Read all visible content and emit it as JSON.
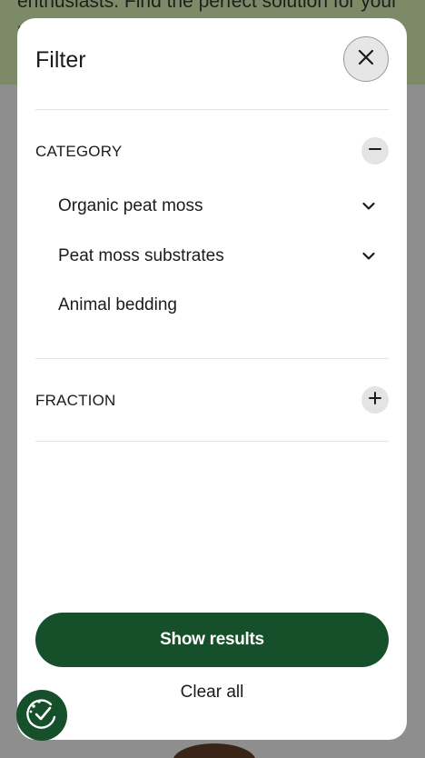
{
  "background": {
    "header_text": "enthusiasts. Find the perfect solution for your plants!"
  },
  "filter": {
    "title": "Filter",
    "close_icon": "close-icon",
    "sections": {
      "category": {
        "label": "CATEGORY",
        "state": "expanded",
        "items": [
          {
            "label": "Organic peat moss",
            "has_submenu": true
          },
          {
            "label": "Peat moss substrates",
            "has_submenu": true
          },
          {
            "label": "Animal bedding",
            "has_submenu": false
          }
        ]
      },
      "fraction": {
        "label": "FRACTION",
        "state": "collapsed"
      }
    },
    "show_results_label": "Show results",
    "clear_all_label": "Clear all"
  },
  "colors": {
    "primary_green": "#16502a",
    "overlay_gray": "#8e8e8e",
    "header_olive": "#7d8a68"
  }
}
